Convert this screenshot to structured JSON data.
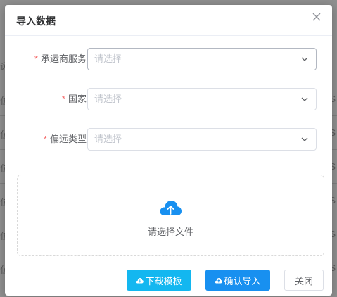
{
  "background_rows": [
    {
      "left": "远",
      "right": ""
    },
    {
      "left": "位",
      "right": "S"
    },
    {
      "left": "位",
      "right": "S"
    },
    {
      "left": "位",
      "right": "S"
    },
    {
      "left": "位",
      "right": "S"
    },
    {
      "left": "位",
      "right": "S"
    },
    {
      "left": "位",
      "right": "S"
    }
  ],
  "dialog": {
    "title": "导入数据",
    "close_icon": "close-icon",
    "form": [
      {
        "required_mark": "*",
        "label": "承运商服务",
        "placeholder": "请选择"
      },
      {
        "required_mark": "*",
        "label": "国家",
        "placeholder": "请选择"
      },
      {
        "required_mark": "*",
        "label": "偏远类型",
        "placeholder": "请选择"
      }
    ],
    "upload": {
      "icon": "cloud-upload-icon",
      "text": "请选择文件",
      "icon_color": "#1890f0"
    },
    "buttons": {
      "download_template": "下载模板",
      "confirm_import": "确认导入",
      "close": "关闭"
    }
  },
  "colors": {
    "required": "#f56c6c",
    "download_button": "#13b7f0",
    "confirm_button": "#1890f0"
  }
}
